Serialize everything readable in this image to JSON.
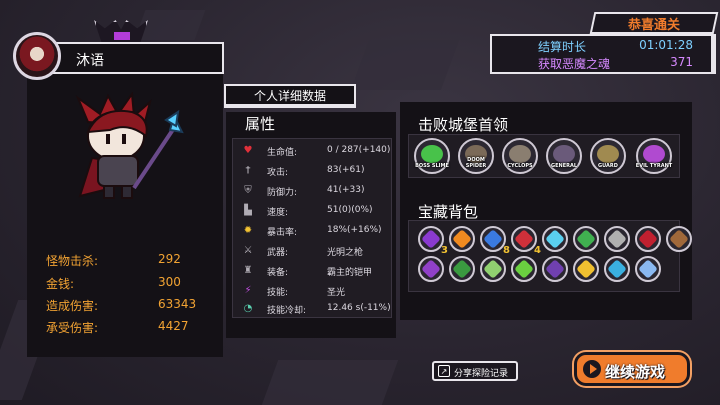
{
  "result": {
    "banner": "恭喜通关",
    "time_label": "结算时长",
    "time_value": "01:01:28",
    "souls_label": "获取恶魔之魂",
    "souls_value": "371"
  },
  "hero": {
    "name": "沐语",
    "stats": [
      {
        "label": "怪物击杀:",
        "value": "292"
      },
      {
        "label": "金钱:",
        "value": "300"
      },
      {
        "label": "造成伤害:",
        "value": "63343"
      },
      {
        "label": "承受伤害:",
        "value": "4427"
      }
    ]
  },
  "detail_tab": "个人详细数据",
  "attributes": {
    "title": "属性",
    "rows": [
      {
        "icon": "heart-icon",
        "label": "生命值:",
        "value": "0 / 287(+140)"
      },
      {
        "icon": "sword-icon",
        "label": "攻击:",
        "value": "83(+61)"
      },
      {
        "icon": "shield-icon",
        "label": "防御力:",
        "value": "41(+33)"
      },
      {
        "icon": "boot-icon",
        "label": "速度:",
        "value": "51(0)(0%)"
      },
      {
        "icon": "burst-icon",
        "label": "暴击率:",
        "value": "18%(+16%)"
      },
      {
        "icon": "weapon-icon",
        "label": "武器:",
        "value": "光明之枪"
      },
      {
        "icon": "armor-icon",
        "label": "装备:",
        "value": "霸主的铠甲"
      },
      {
        "icon": "skill-icon",
        "label": "技能:",
        "value": "圣光"
      },
      {
        "icon": "cooldown-icon",
        "label": "技能冷却:",
        "value": "12.46 s(-11%)"
      }
    ]
  },
  "bosses": {
    "title": "击败城堡首领",
    "list": [
      {
        "caption": "BOSS SLIME",
        "color": "#48c24a"
      },
      {
        "caption": "DOOM SPIDER",
        "color": "#7b6a58"
      },
      {
        "caption": "CYCLOPS",
        "color": "#8a7e70"
      },
      {
        "caption": "GENERAL",
        "color": "#6a5a7a"
      },
      {
        "caption": "GUARD",
        "color": "#a08a50"
      },
      {
        "caption": "EVIL TYRANT",
        "color": "#b04ad0"
      }
    ]
  },
  "bag": {
    "title": "宝藏背包",
    "items": [
      {
        "name": "purple-crystal-icon",
        "color": "#8a3ad0",
        "count": "3"
      },
      {
        "name": "flame-gem-icon",
        "color": "#f08a20",
        "count": ""
      },
      {
        "name": "blue-orb-icon",
        "color": "#3a7ae0",
        "count": "8"
      },
      {
        "name": "red-heart-icon",
        "color": "#d0303a",
        "count": "4"
      },
      {
        "name": "ice-sword-icon",
        "color": "#5ad0f0",
        "count": ""
      },
      {
        "name": "green-sword-icon",
        "color": "#40b050",
        "count": ""
      },
      {
        "name": "gauntlet-icon",
        "color": "#b0b0b0",
        "count": ""
      },
      {
        "name": "red-claw-icon",
        "color": "#c02030",
        "count": ""
      },
      {
        "name": "brown-claw-icon",
        "color": "#a0683a",
        "count": ""
      },
      {
        "name": "purple-scythe-icon",
        "color": "#9040c8",
        "count": ""
      },
      {
        "name": "green-helmet-icon",
        "color": "#3a9a40",
        "count": ""
      },
      {
        "name": "green-egg-icon",
        "color": "#90d070",
        "count": ""
      },
      {
        "name": "dragon-eye-icon",
        "color": "#6ad040",
        "count": ""
      },
      {
        "name": "dark-shield-icon",
        "color": "#7040b0",
        "count": ""
      },
      {
        "name": "gold-wings-icon",
        "color": "#f0c030",
        "count": ""
      },
      {
        "name": "blue-swirl-icon",
        "color": "#3ab0e0",
        "count": ""
      },
      {
        "name": "crystal-spear-icon",
        "color": "#8ab8f0",
        "count": ""
      }
    ]
  },
  "buttons": {
    "share": "分享探险记录",
    "continue": "继续游戏"
  },
  "colors": {
    "accent_orange": "#f07c2c",
    "stat_orange": "#f2a333",
    "time_blue": "#7ed0ff",
    "souls_purple": "#d689ff"
  }
}
